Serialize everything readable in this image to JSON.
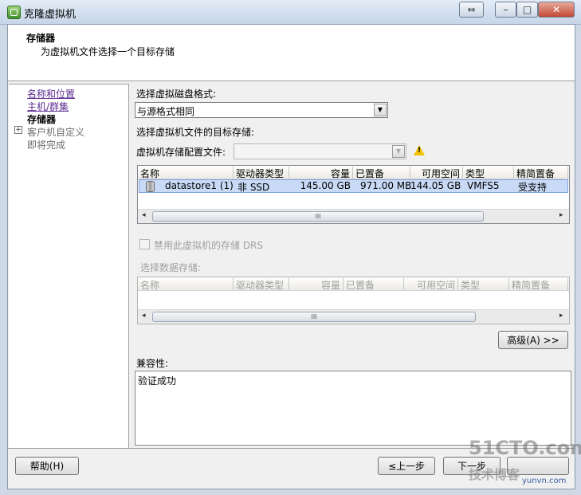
{
  "window": {
    "title": "克隆虚拟机",
    "buttons": {
      "restore": "⇔",
      "minimize": "–",
      "maximize": "□",
      "close": "✕"
    }
  },
  "header": {
    "title": "存储器",
    "subtitle": "为虚拟机文件选择一个目标存储"
  },
  "nav": {
    "items": [
      {
        "label": "名称和位置",
        "state": "link"
      },
      {
        "label": "主机/群集",
        "state": "link"
      },
      {
        "label": "存储器",
        "state": "current"
      },
      {
        "label": "客户机自定义",
        "state": "disabled"
      },
      {
        "label": "即将完成",
        "state": "disabled"
      }
    ],
    "expand_glyph": "+"
  },
  "disk_format": {
    "label": "选择虚拟磁盘格式:",
    "selected": "与源格式相同"
  },
  "target_label": "选择虚拟机文件的目标存储:",
  "profile": {
    "label": "虚拟机存储配置文件:",
    "value": ""
  },
  "datastore_table": {
    "columns": [
      "名称",
      "驱动器类型",
      "容量",
      "已置备",
      "可用空间",
      "类型",
      "精简置备"
    ],
    "rows": [
      {
        "name": "datastore1 (1)",
        "drive": "非 SSD",
        "capacity": "145.00 GB",
        "provisioned": "971.00 MB",
        "free": "144.05 GB",
        "type": "VMFS5",
        "thin": "受支持"
      }
    ]
  },
  "drs": {
    "label": "禁用此虚拟机的存储 DRS",
    "checked": false
  },
  "select_datastore": {
    "label": "选择数据存储:",
    "columns": [
      "名称",
      "驱动器类型",
      "容量",
      "已置备",
      "可用空间",
      "类型",
      "精简置备"
    ]
  },
  "scroll_grip": "III",
  "advanced_button": "高级(A) >>",
  "compat": {
    "label": "兼容性:",
    "value": "验证成功"
  },
  "footer": {
    "help": "帮助(H)",
    "back": "≤上一步",
    "next": "下一步"
  },
  "watermark": {
    "line1": "51CTO.com",
    "line2": "技术博客",
    "line3": "yunvn.com"
  },
  "colors": {
    "selection": "#c9daf6",
    "link": "#5c2d91",
    "warning": "#f2c200"
  }
}
